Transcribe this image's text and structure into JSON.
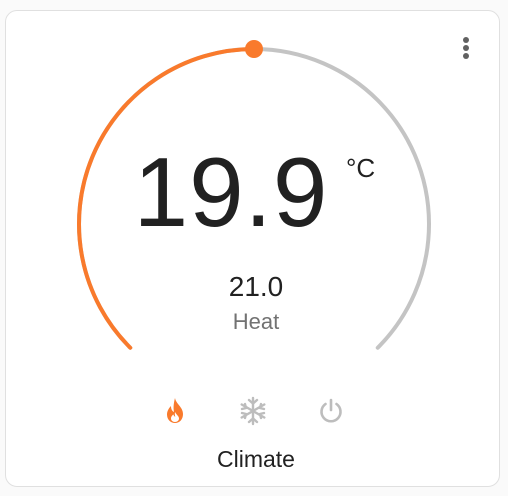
{
  "card": {
    "current_temperature": "19.9",
    "unit": "°C",
    "target_temperature": "21.0",
    "hvac_mode": "Heat",
    "name": "Climate",
    "setpoint_fraction": 0.5
  },
  "modes": [
    {
      "name": "heat",
      "icon": "fire-icon",
      "active": true
    },
    {
      "name": "cool",
      "icon": "snowflake-icon",
      "active": false
    },
    {
      "name": "off",
      "icon": "power-icon",
      "active": false
    }
  ],
  "colors": {
    "heat_accent": "#f97a2c",
    "track": "#c4c4c4",
    "inactive_icon": "#bdbdbd",
    "text": "#212121",
    "secondary_text": "#727272"
  },
  "menu_icon": "more-vertical-icon"
}
